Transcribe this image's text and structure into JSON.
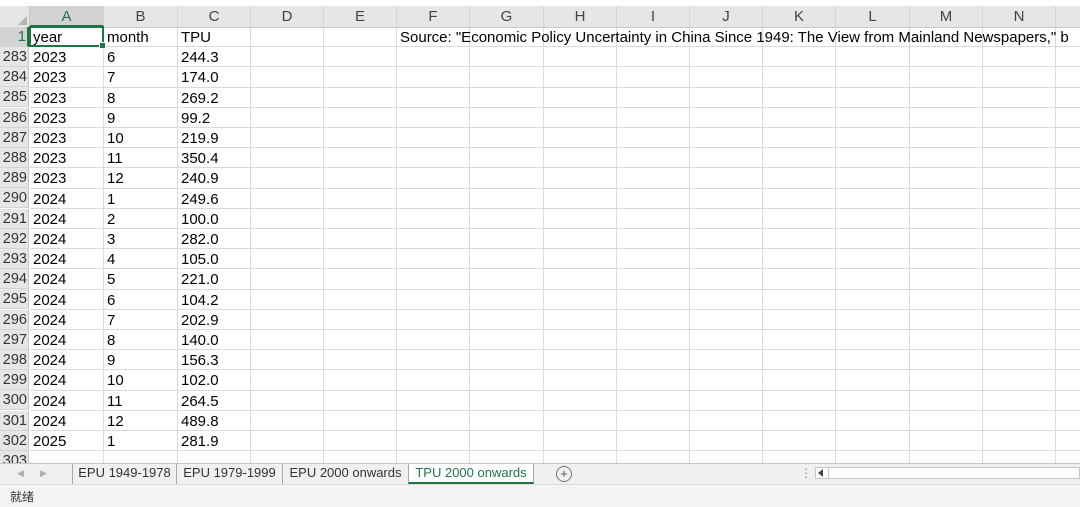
{
  "columns": [
    "A",
    "B",
    "C",
    "D",
    "E",
    "F",
    "G",
    "H",
    "I",
    "J",
    "K",
    "L",
    "M",
    "N"
  ],
  "header_row": {
    "row_number": "1",
    "cells": [
      "year",
      "month",
      "TPU"
    ],
    "source_note": "Source: \"Economic Policy Uncertainty in China Since 1949: The View from Mainland Newspapers,\" b"
  },
  "rows": [
    {
      "num": "283",
      "year": "2023",
      "month": "6",
      "tpu": "244.3"
    },
    {
      "num": "284",
      "year": "2023",
      "month": "7",
      "tpu": "174.0"
    },
    {
      "num": "285",
      "year": "2023",
      "month": "8",
      "tpu": "269.2"
    },
    {
      "num": "286",
      "year": "2023",
      "month": "9",
      "tpu": "99.2"
    },
    {
      "num": "287",
      "year": "2023",
      "month": "10",
      "tpu": "219.9"
    },
    {
      "num": "288",
      "year": "2023",
      "month": "11",
      "tpu": "350.4"
    },
    {
      "num": "289",
      "year": "2023",
      "month": "12",
      "tpu": "240.9"
    },
    {
      "num": "290",
      "year": "2024",
      "month": "1",
      "tpu": "249.6"
    },
    {
      "num": "291",
      "year": "2024",
      "month": "2",
      "tpu": "100.0"
    },
    {
      "num": "292",
      "year": "2024",
      "month": "3",
      "tpu": "282.0"
    },
    {
      "num": "293",
      "year": "2024",
      "month": "4",
      "tpu": "105.0"
    },
    {
      "num": "294",
      "year": "2024",
      "month": "5",
      "tpu": "221.0"
    },
    {
      "num": "295",
      "year": "2024",
      "month": "6",
      "tpu": "104.2"
    },
    {
      "num": "296",
      "year": "2024",
      "month": "7",
      "tpu": "202.9"
    },
    {
      "num": "297",
      "year": "2024",
      "month": "8",
      "tpu": "140.0"
    },
    {
      "num": "298",
      "year": "2024",
      "month": "9",
      "tpu": "156.3"
    },
    {
      "num": "299",
      "year": "2024",
      "month": "10",
      "tpu": "102.0"
    },
    {
      "num": "300",
      "year": "2024",
      "month": "11",
      "tpu": "264.5"
    },
    {
      "num": "301",
      "year": "2024",
      "month": "12",
      "tpu": "489.8"
    },
    {
      "num": "302",
      "year": "2025",
      "month": "1",
      "tpu": "281.9"
    }
  ],
  "partial_row_number": "303",
  "sheet_tabs": [
    {
      "label": "EPU 1949-1978",
      "active": false
    },
    {
      "label": "EPU 1979-1999",
      "active": false
    },
    {
      "label": "EPU 2000 onwards",
      "active": false
    },
    {
      "label": "TPU 2000 onwards",
      "active": true
    }
  ],
  "add_sheet_symbol": "+",
  "tab_nav": {
    "prev": "◀",
    "next": "▶"
  },
  "scroll_dots": "⋮",
  "status": "就绪",
  "accent_color": "#217346"
}
